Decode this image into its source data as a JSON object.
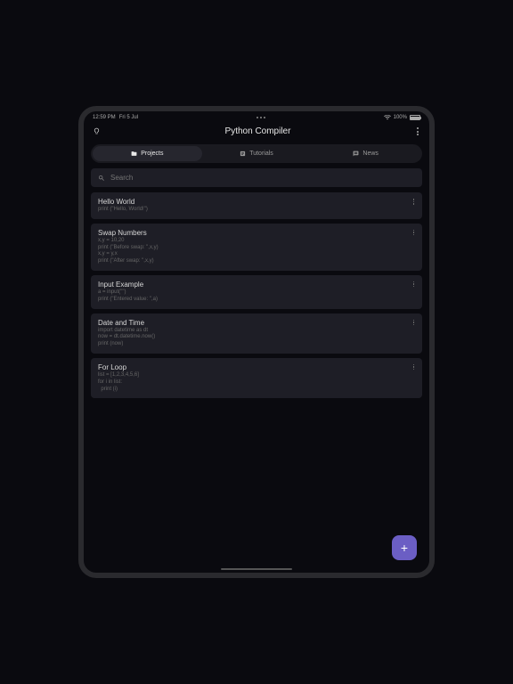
{
  "status": {
    "time": "12:59 PM",
    "date": "Fri 5 Jul",
    "battery": "100%"
  },
  "header": {
    "title": "Python Compiler"
  },
  "tabs": {
    "projects": "Projects",
    "tutorials": "Tutorials",
    "news": "News"
  },
  "search": {
    "placeholder": "Search"
  },
  "projects": [
    {
      "title": "Hello World",
      "code": "print (\"Hello, World!\")"
    },
    {
      "title": "Swap Numbers",
      "code": "x,y = 10,20\nprint (\"Before swap: \",x,y)\nx,y = y,x\nprint (\"After swap: \",x,y)"
    },
    {
      "title": "Input Example",
      "code": "a = input(\"\")\nprint (\"Entered value: \",a)"
    },
    {
      "title": "Date and Time",
      "code": "import datetime as dt\nnow = dt.datetime.now()\nprint (now)"
    },
    {
      "title": "For Loop",
      "code": "list = [1,2,3,4,5,6]\nfor i in list:\n  print (i)"
    }
  ],
  "fab": {
    "label": "+"
  }
}
